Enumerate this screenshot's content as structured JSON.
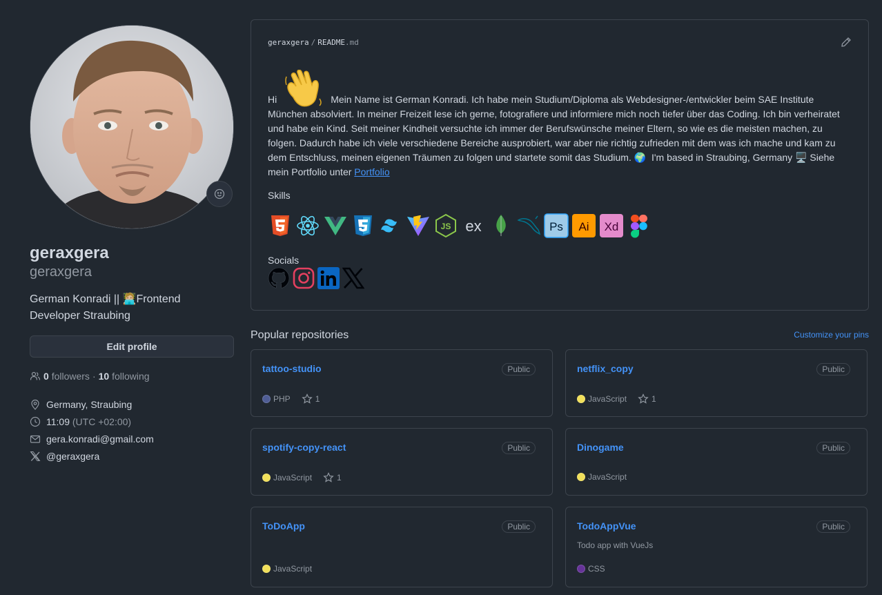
{
  "profile": {
    "fullname": "geraxgera",
    "username": "geraxgera",
    "bio_before": "German Konradi || ",
    "bio_emoji": "🧑🏼‍💻",
    "bio_after": "Frontend Developer Straubing",
    "edit_label": "Edit profile",
    "followers_count": "0",
    "followers_label": "followers",
    "following_count": "10",
    "following_label": "following",
    "dot": "·",
    "location": "Germany, Straubing",
    "time": "11:09",
    "timezone": "(UTC +02:00)",
    "email": "gera.konradi@gmail.com",
    "twitter": "@geraxgera"
  },
  "readme": {
    "owner": "geraxgera",
    "sep": "/",
    "file_base": "README",
    "file_ext": ".md",
    "intro_hi": "Hi",
    "intro_text": "Mein Name ist German Konradi. Ich habe mein Studium/Diploma als Webdesigner-/entwickler beim SAE Institute München absolviert. In meiner Freizeit lese ich gerne, fotografiere und informiere mich noch tiefer über das Coding. Ich bin verheiratet und habe ein Kind. Seit meiner Kindheit versuchte ich immer der Berufswünsche meiner Eltern, so wie es die meisten machen, zu folgen. Dadurch habe ich viele verschiedene Bereiche ausprobiert, war aber nie richtig zufrieden mit dem was ich mache und kam zu dem Entschluss, meinen eigenen Träumen zu folgen und startete somit das Studium.",
    "globe": "🌍",
    "based": "I'm based in Straubing, Germany",
    "computer": "🖥️",
    "portfolio_pre": "Siehe mein Portfolio unter",
    "portfolio_link": "Portfolio",
    "skills_label": "Skills",
    "socials_label": "Socials",
    "skill_icons": [
      "html5-icon",
      "react-icon",
      "vue-icon",
      "css3-icon",
      "tailwind-icon",
      "vite-icon",
      "nodejs-icon",
      "express-icon",
      "mongodb-icon",
      "mysql-icon",
      "photoshop-icon",
      "illustrator-icon",
      "xd-icon",
      "figma-icon"
    ],
    "social_icons": [
      "github-icon",
      "instagram-icon",
      "linkedin-icon",
      "x-icon"
    ]
  },
  "popular": {
    "title": "Popular repositories",
    "customize": "Customize your pins",
    "repos": [
      {
        "name": "tattoo-studio",
        "badge": "Public",
        "desc": "",
        "lang": "PHP",
        "lang_color": "#4F5D95",
        "stars": "1"
      },
      {
        "name": "netflix_copy",
        "badge": "Public",
        "desc": "",
        "lang": "JavaScript",
        "lang_color": "#f1e05a",
        "stars": "1"
      },
      {
        "name": "spotify-copy-react",
        "badge": "Public",
        "desc": "",
        "lang": "JavaScript",
        "lang_color": "#f1e05a",
        "stars": "1"
      },
      {
        "name": "Dinogame",
        "badge": "Public",
        "desc": "",
        "lang": "JavaScript",
        "lang_color": "#f1e05a",
        "stars": ""
      },
      {
        "name": "ToDoApp",
        "badge": "Public",
        "desc": "",
        "lang": "JavaScript",
        "lang_color": "#f1e05a",
        "stars": ""
      },
      {
        "name": "TodoAppVue",
        "badge": "Public",
        "desc": "Todo app with VueJs",
        "lang": "CSS",
        "lang_color": "#663399",
        "stars": ""
      }
    ]
  },
  "colors": {
    "bg": "#212830",
    "border": "#3d444d",
    "link": "#4493f8",
    "muted": "#9198a1",
    "text": "#d1d7e0"
  }
}
